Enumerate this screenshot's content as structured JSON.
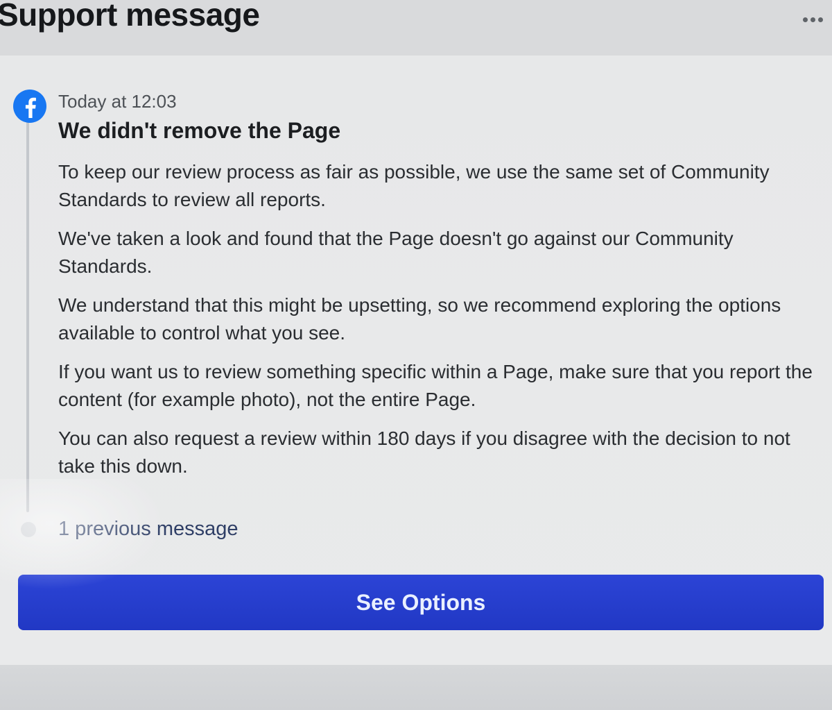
{
  "header": {
    "title": "Support message",
    "more_icon": "more-horizontal-icon"
  },
  "message": {
    "sender_icon": "facebook-icon",
    "timestamp": "Today at 12:03",
    "title": "We didn't remove the Page",
    "paragraphs": [
      "To keep our review process as fair as possible, we use the same set of Community Standards to review all reports.",
      "We've taken a look and found that the Page doesn't go against our Community Standards.",
      "We understand that this might be upsetting, so we recommend exploring the options available to control what you see.",
      "If you want us to review something specific within a Page, make sure that you report the content (for example photo), not the entire Page.",
      "You can also request a review within 180 days if you disagree with the decision to not take this down."
    ]
  },
  "previous_messages_link": "1 previous message",
  "primary_button": {
    "label": "See Options"
  },
  "colors": {
    "accent": "#1877F2",
    "button": "#2c44d6",
    "link": "#2f3f66"
  }
}
